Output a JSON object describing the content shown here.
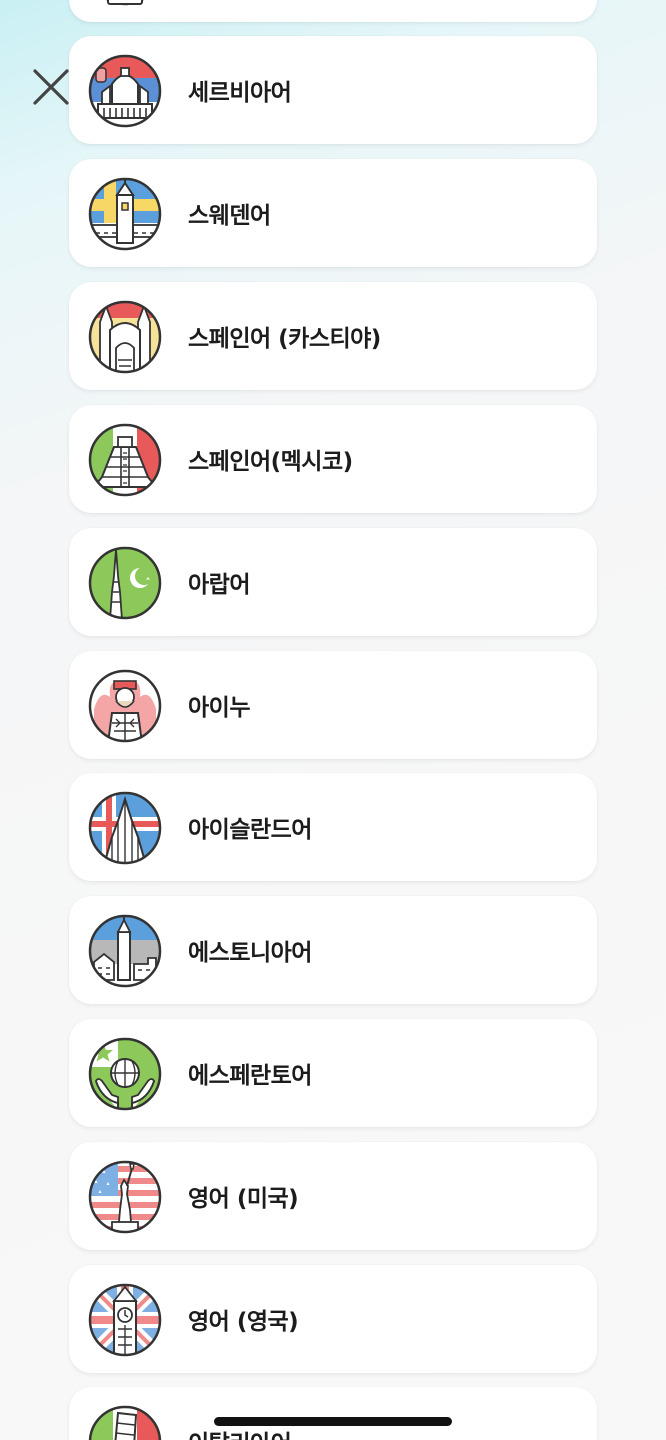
{
  "languages": [
    {
      "label": "",
      "icon": "language-landmark-icon"
    },
    {
      "label": "세르비아어",
      "icon": "serbia-landmark-icon"
    },
    {
      "label": "스웨덴어",
      "icon": "sweden-landmark-icon"
    },
    {
      "label": "스페인어 (카스티야)",
      "icon": "spain-landmark-icon"
    },
    {
      "label": "스페인어(멕시코)",
      "icon": "mexico-landmark-icon"
    },
    {
      "label": "아랍어",
      "icon": "arabic-landmark-icon"
    },
    {
      "label": "아이누",
      "icon": "ainu-icon"
    },
    {
      "label": "아이슬란드어",
      "icon": "iceland-landmark-icon"
    },
    {
      "label": "에스토니아어",
      "icon": "estonia-landmark-icon"
    },
    {
      "label": "에스페란토어",
      "icon": "esperanto-globe-icon"
    },
    {
      "label": "영어 (미국)",
      "icon": "statue-of-liberty-icon"
    },
    {
      "label": "영어 (영국)",
      "icon": "big-ben-icon"
    },
    {
      "label": "이탈리아어",
      "icon": "leaning-tower-icon"
    }
  ],
  "colors": {
    "card": "#ffffff",
    "text": "#1c1c1c",
    "outline": "#333333"
  }
}
